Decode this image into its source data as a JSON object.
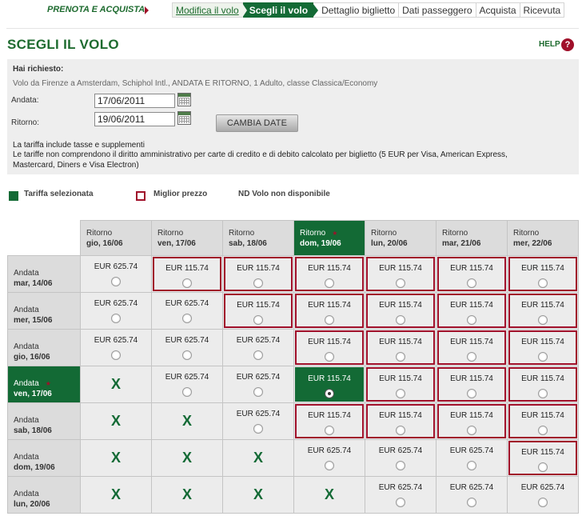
{
  "nav": {
    "brand": "PRENOTA E ACQUISTA",
    "steps": [
      "Modifica il volo",
      "Scegli il volo",
      "Dettaglio biglietto",
      "Dati passeggero",
      "Acquista",
      "Ricevuta"
    ]
  },
  "page": {
    "title": "SCEGLI IL VOLO",
    "help": "HELP",
    "help_icon": "?"
  },
  "request": {
    "heading": "Hai richiesto:",
    "description": "Volo da Firenze a Amsterdam, Schiphol Intl., ANDATA E RITORNO, 1 Adulto, classe Classica/Economy",
    "andata_label": "Andata:",
    "andata_value": "17/06/2011",
    "ritorno_label": "Ritorno:",
    "ritorno_value": "19/06/2011",
    "change_button": "CAMBIA DATE",
    "note1": "La tariffa include tasse e supplementi",
    "note2": "Le tariffe non comprendono il diritto amministrativo per carte di credito e di debito calcolato per biglietto (5 EUR per Visa, American Express,",
    "note3": "Mastercard, Diners e Visa Electron)"
  },
  "legend": {
    "selected": "Tariffa selezionata",
    "best": "Miglior prezzo",
    "nd": "ND Volo non disponibile"
  },
  "colors": {
    "brand_green": "#136a35",
    "best_red": "#a0102a"
  },
  "grid": {
    "ritorno_label": "Ritorno",
    "andata_label": "Andata",
    "unavailable_mark": "X",
    "columns": [
      "gio, 16/06",
      "ven, 17/06",
      "sab, 18/06",
      "dom, 19/06",
      "lun, 20/06",
      "mar, 21/06",
      "mer, 22/06"
    ],
    "selected_column": 3,
    "rows": [
      {
        "date": "mar, 14/06",
        "cells": [
          {
            "p": "EUR 625.74",
            "b": false
          },
          {
            "p": "EUR 115.74",
            "b": true
          },
          {
            "p": "EUR 115.74",
            "b": true
          },
          {
            "p": "EUR 115.74",
            "b": true
          },
          {
            "p": "EUR 115.74",
            "b": true
          },
          {
            "p": "EUR 115.74",
            "b": true
          },
          {
            "p": "EUR 115.74",
            "b": true
          }
        ]
      },
      {
        "date": "mer, 15/06",
        "cells": [
          {
            "p": "EUR 625.74",
            "b": false
          },
          {
            "p": "EUR 625.74",
            "b": false
          },
          {
            "p": "EUR 115.74",
            "b": true
          },
          {
            "p": "EUR 115.74",
            "b": true
          },
          {
            "p": "EUR 115.74",
            "b": true
          },
          {
            "p": "EUR 115.74",
            "b": true
          },
          {
            "p": "EUR 115.74",
            "b": true
          }
        ]
      },
      {
        "date": "gio, 16/06",
        "cells": [
          {
            "p": "EUR 625.74",
            "b": false
          },
          {
            "p": "EUR 625.74",
            "b": false
          },
          {
            "p": "EUR 625.74",
            "b": false
          },
          {
            "p": "EUR 115.74",
            "b": true
          },
          {
            "p": "EUR 115.74",
            "b": true
          },
          {
            "p": "EUR 115.74",
            "b": true
          },
          {
            "p": "EUR 115.74",
            "b": true
          }
        ]
      },
      {
        "date": "ven, 17/06",
        "selected": true,
        "cells": [
          {
            "x": true
          },
          {
            "p": "EUR 625.74",
            "b": false
          },
          {
            "p": "EUR 625.74",
            "b": false
          },
          {
            "p": "EUR 115.74",
            "b": true,
            "s": true
          },
          {
            "p": "EUR 115.74",
            "b": true
          },
          {
            "p": "EUR 115.74",
            "b": true
          },
          {
            "p": "EUR 115.74",
            "b": true
          }
        ]
      },
      {
        "date": "sab, 18/06",
        "cells": [
          {
            "x": true
          },
          {
            "x": true
          },
          {
            "p": "EUR 625.74",
            "b": false
          },
          {
            "p": "EUR 115.74",
            "b": true
          },
          {
            "p": "EUR 115.74",
            "b": true
          },
          {
            "p": "EUR 115.74",
            "b": true
          },
          {
            "p": "EUR 115.74",
            "b": true
          }
        ]
      },
      {
        "date": "dom, 19/06",
        "cells": [
          {
            "x": true
          },
          {
            "x": true
          },
          {
            "x": true
          },
          {
            "p": "EUR 625.74",
            "b": false
          },
          {
            "p": "EUR 625.74",
            "b": false
          },
          {
            "p": "EUR 625.74",
            "b": false
          },
          {
            "p": "EUR 115.74",
            "b": true
          }
        ]
      },
      {
        "date": "lun, 20/06",
        "cells": [
          {
            "x": true
          },
          {
            "x": true
          },
          {
            "x": true
          },
          {
            "x": true
          },
          {
            "p": "EUR 625.74",
            "b": false
          },
          {
            "p": "EUR 625.74",
            "b": false
          },
          {
            "p": "EUR 625.74",
            "b": false
          }
        ]
      }
    ]
  }
}
